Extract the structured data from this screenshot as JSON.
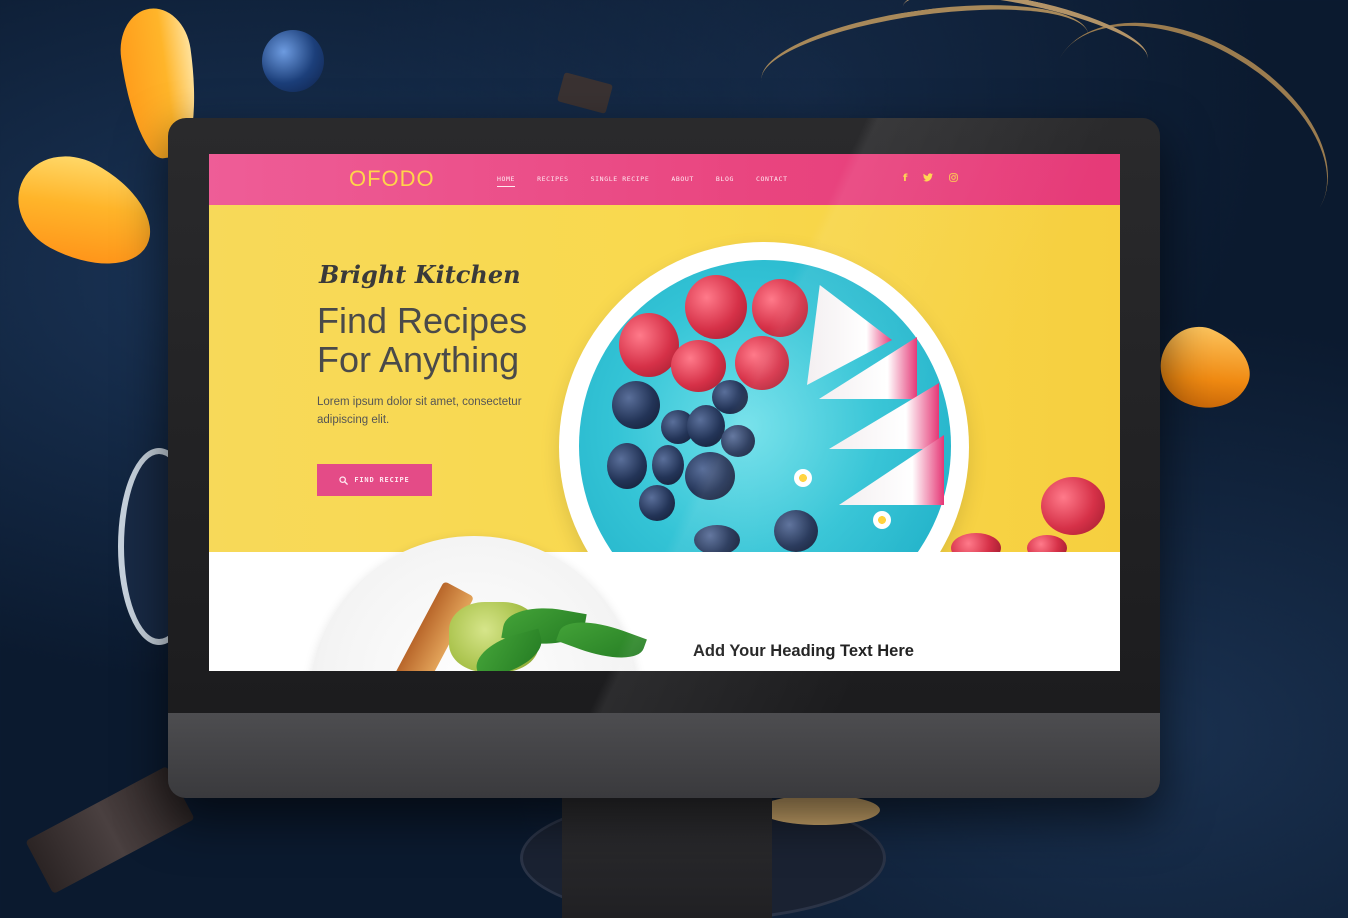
{
  "nav": {
    "logo": "OFODO",
    "menu": [
      {
        "label": "HOME",
        "active": true
      },
      {
        "label": "RECIPES",
        "active": false
      },
      {
        "label": "SINGLE RECIPE",
        "active": false
      },
      {
        "label": "ABOUT",
        "active": false
      },
      {
        "label": "BLOG",
        "active": false
      },
      {
        "label": "CONTACT",
        "active": false
      }
    ],
    "social": [
      {
        "icon": "facebook-icon",
        "glyph": "f"
      },
      {
        "icon": "twitter-icon",
        "glyph": "🐦"
      },
      {
        "icon": "instagram-icon",
        "glyph": "◎"
      }
    ]
  },
  "hero": {
    "tagline": "Bright Kitchen",
    "title_line1": "Find Recipes",
    "title_line2": "For Anything",
    "text": "Lorem ipsum dolor sit amet, consectetur adipiscing elit.",
    "button_label": "FIND RECIPE"
  },
  "section2": {
    "heading": "Add Your Heading Text Here"
  },
  "colors": {
    "nav_pink": "#e9457f",
    "hero_yellow": "#f9d94e",
    "accent_yellow": "#ffd54a",
    "button_pink": "#e44b87"
  }
}
